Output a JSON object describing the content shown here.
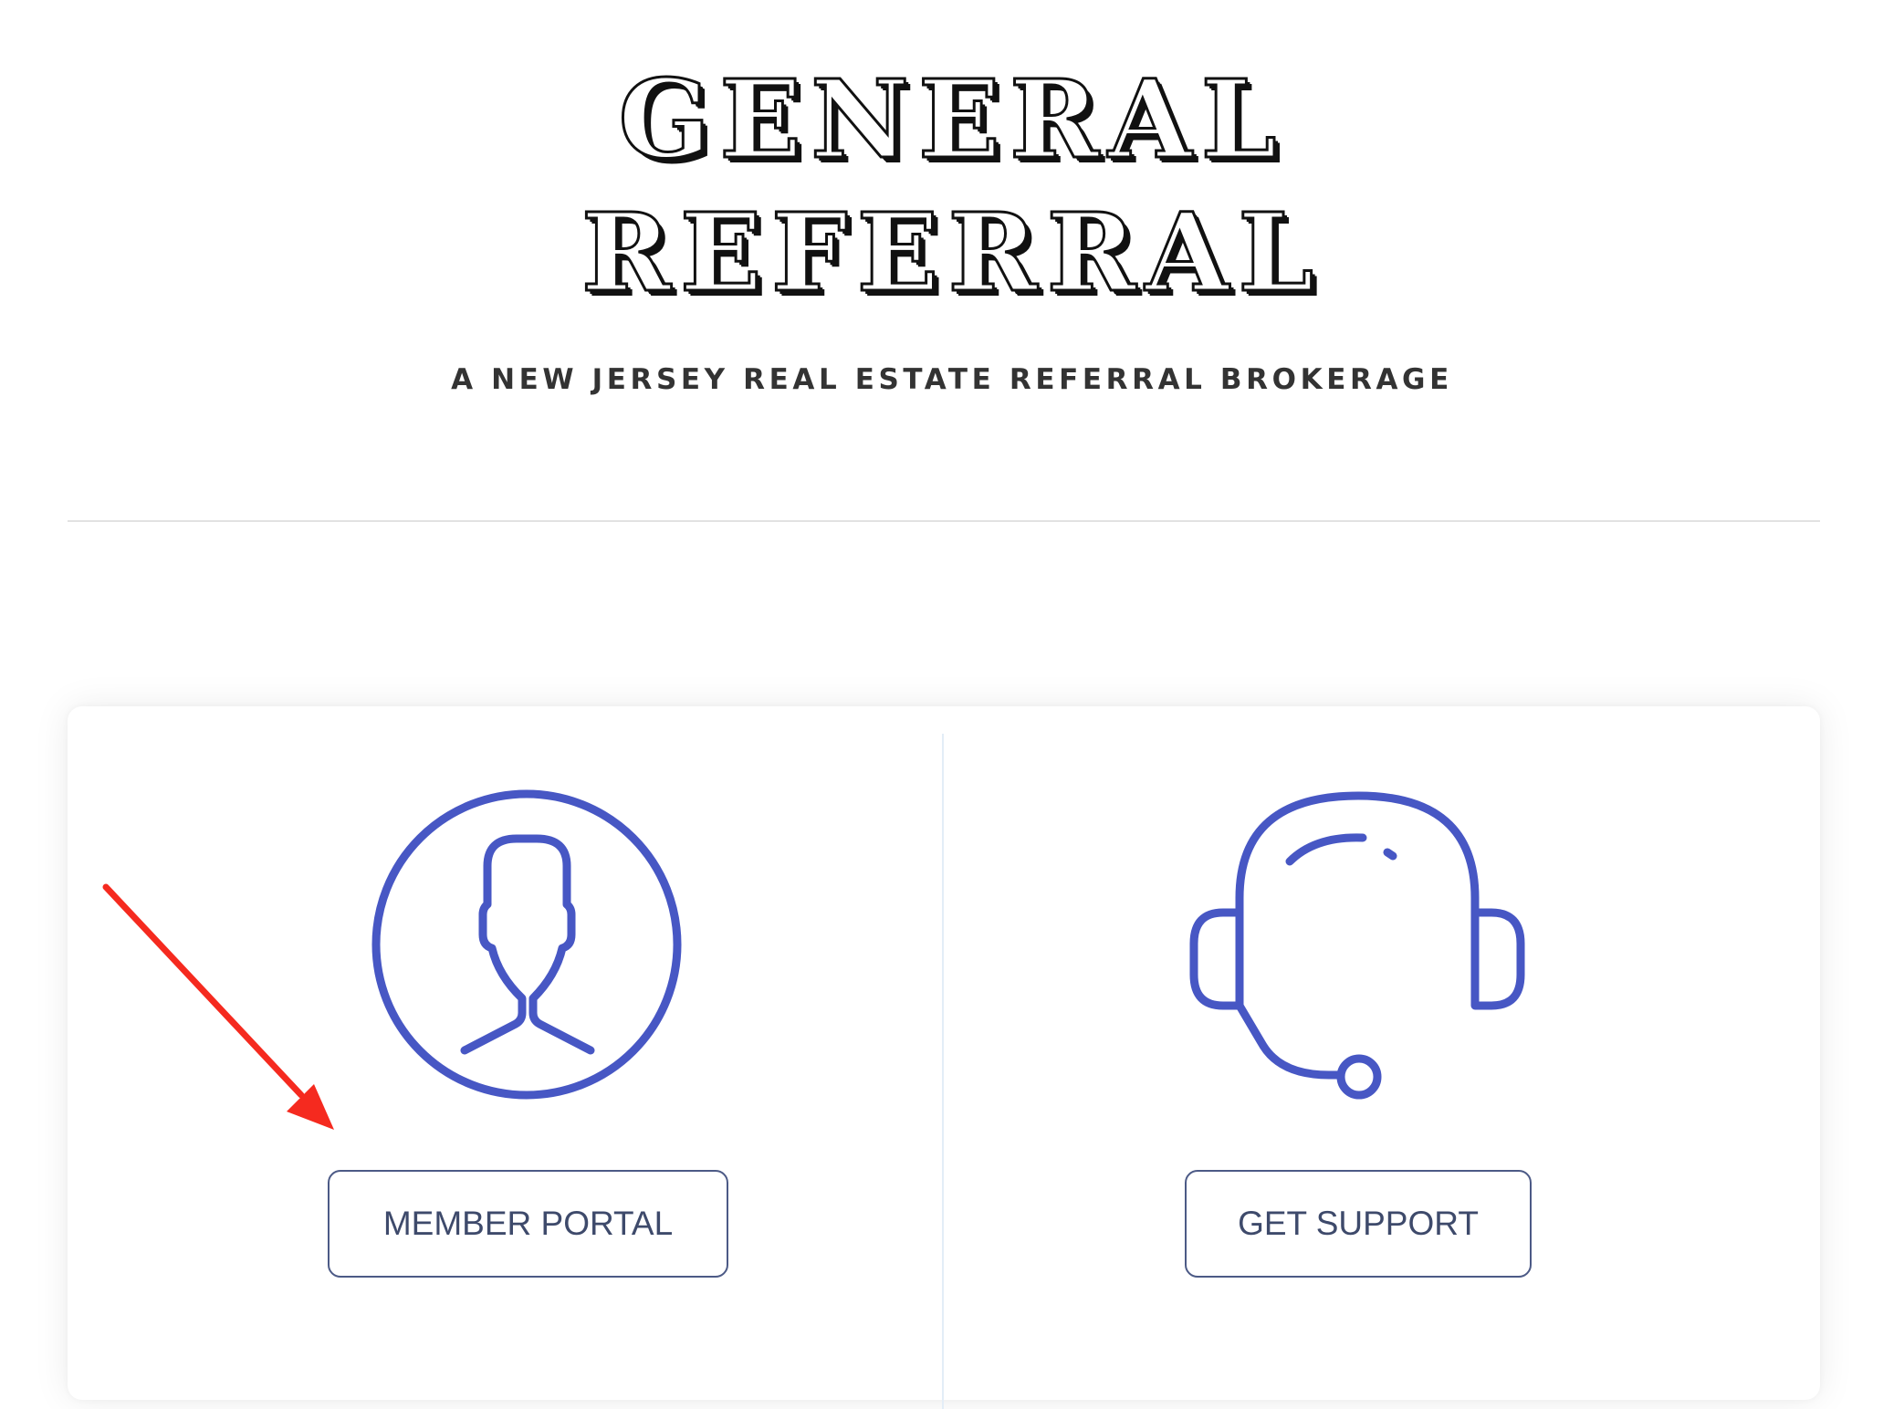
{
  "header": {
    "title_line1": "GENERAL",
    "title_line2": "REFERRAL",
    "tagline": "A NEW JERSEY REAL ESTATE REFERRAL BROKERAGE"
  },
  "cards": {
    "member": {
      "icon": "user-circle-icon",
      "button_label": "MEMBER PORTAL"
    },
    "support": {
      "icon": "headset-icon",
      "button_label": "GET SUPPORT"
    }
  },
  "annotation": {
    "icon": "red-arrow-icon",
    "color": "#f52a1f"
  },
  "colors": {
    "icon_blue": "#4757c4",
    "button_border": "#4c5a86",
    "button_text": "#3e4a6b",
    "tagline": "#333333"
  }
}
